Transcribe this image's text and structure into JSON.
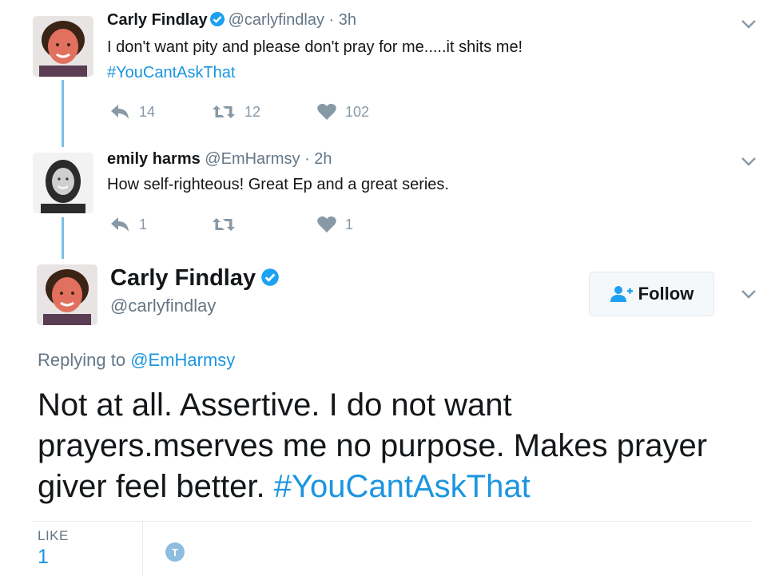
{
  "tweets": [
    {
      "name": "Carly Findlay",
      "handle": "@carlyfindlay",
      "time": "· 3h",
      "text": "I don't want pity and please don't pray for me.....it shits me!",
      "hashtag": "#YouCantAskThat",
      "replies": "14",
      "retweets": "12",
      "likes": "102"
    },
    {
      "name": "emily harms",
      "handle": "@EmHarmsy",
      "time": "· 2h",
      "text": "How self-righteous! Great Ep and a great series.",
      "replies": "1",
      "retweets": "",
      "likes": "1"
    }
  ],
  "main": {
    "name": "Carly Findlay",
    "handle": "@carlyfindlay",
    "follow_label": "Follow",
    "replying_prefix": "Replying to",
    "replying_to": "@EmHarmsy",
    "text": "Not at all. Assertive. I do not want prayers.mserves me no purpose. Makes prayer giver feel better.",
    "hashtag": "#YouCantAskThat",
    "like_label": "LIKE",
    "like_count": "1",
    "liker_initial": "T"
  },
  "icons": {
    "reply": "reply-icon",
    "retweet": "retweet-icon",
    "like": "heart-icon",
    "verified": "verified-badge-icon",
    "more": "chevron-down-icon",
    "follow": "add-user-icon"
  },
  "colors": {
    "link": "#1b95e0",
    "thread_line": "#79c0e6",
    "muted": "#8899a6"
  }
}
